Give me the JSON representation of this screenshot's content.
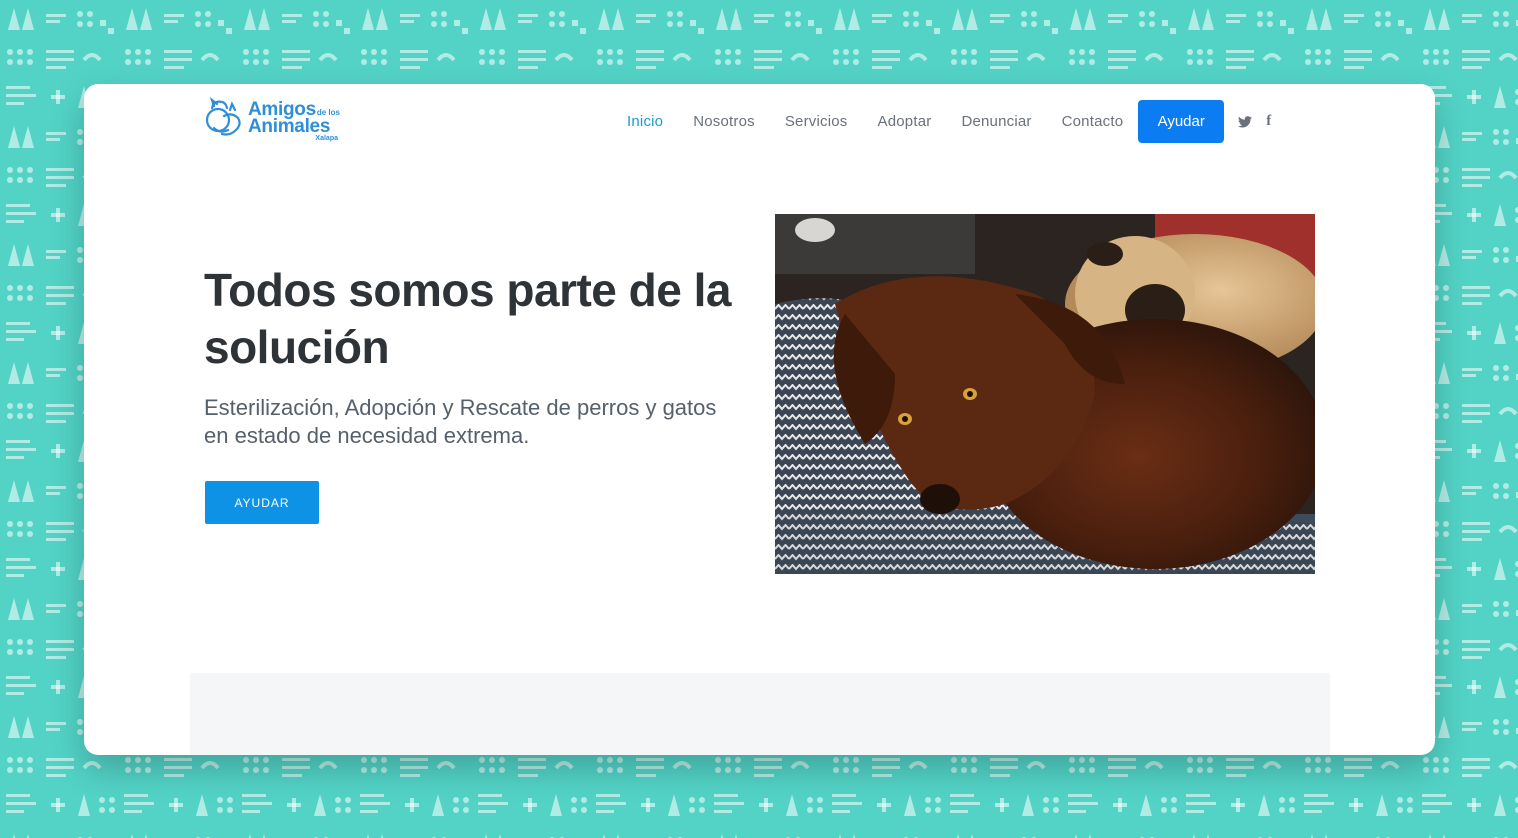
{
  "brand": {
    "logo_line1": "Amigos",
    "logo_delos": "de los",
    "logo_line2": "Animales",
    "logo_city": "Xalapa"
  },
  "nav": {
    "items": [
      {
        "label": "Inicio",
        "active": true
      },
      {
        "label": "Nosotros",
        "active": false
      },
      {
        "label": "Servicios",
        "active": false
      },
      {
        "label": "Adoptar",
        "active": false
      },
      {
        "label": "Denunciar",
        "active": false
      },
      {
        "label": "Contacto",
        "active": false
      }
    ],
    "cta_label": "Ayudar",
    "social": [
      {
        "icon": "twitter-icon"
      },
      {
        "icon": "facebook-icon",
        "glyph": "f"
      }
    ]
  },
  "hero": {
    "title": "Todos somos parte de la solución",
    "subtitle": "Esterilización, Adopción y Rescate de perros y gatos en estado de necesidad extrema.",
    "button_label": "AYUDAR"
  },
  "colors": {
    "background": "#52d3c6",
    "accent": "#0c7cf2",
    "active_link": "#1a9ad0",
    "heading": "#2e3338"
  }
}
